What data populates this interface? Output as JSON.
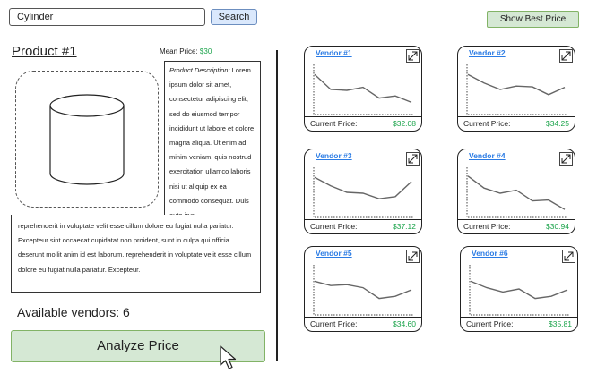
{
  "search": {
    "value": "Cylinder",
    "button_label": "Search"
  },
  "best_price_button": "Show Best Price",
  "product": {
    "title": "Product #1",
    "mean_price_label": "Mean Price:",
    "mean_price_value": "$30",
    "description_label": "Product Description:",
    "description_top": "Lorem ipsum dolor sit amet, consectetur adipiscing elit, sed do eiusmod tempor incididunt ut labore et dolore magna aliqua. Ut enim ad minim veniam, quis nostrud exercitation ullamco laboris nisi ut aliquip ex ea commodo consequat. Duis aute irur.",
    "description_bottom": "reprehenderit in voluptate velit esse cillum dolore eu fugiat nulla pariatur. Excepteur sint occaecat cupidatat non proident, sunt in culpa qui officia deserunt mollit anim id est laborum. reprehenderit in voluptate velit esse cillum dolore eu fugiat nulla pariatur. Excepteur."
  },
  "available_vendors": "Available vendors: 6",
  "analyze_button": "Analyze Price",
  "vendors": [
    {
      "name": "Vendor #1",
      "price_label": "Current Price:",
      "price": "$32.08",
      "trend": [
        0.85,
        0.5,
        0.48,
        0.55,
        0.3,
        0.35,
        0.2
      ]
    },
    {
      "name": "Vendor #2",
      "price_label": "Current Price:",
      "price": "$34.25",
      "trend": [
        0.85,
        0.65,
        0.5,
        0.58,
        0.56,
        0.38,
        0.55
      ]
    },
    {
      "name": "Vendor #3",
      "price_label": "Current Price:",
      "price": "$37.12",
      "trend": [
        0.85,
        0.65,
        0.5,
        0.48,
        0.35,
        0.4,
        0.75
      ]
    },
    {
      "name": "Vendor #4",
      "price_label": "Current Price:",
      "price": "$30.94",
      "trend": [
        0.88,
        0.6,
        0.48,
        0.55,
        0.3,
        0.32,
        0.1
      ]
    },
    {
      "name": "Vendor #5",
      "price_label": "Current Price:",
      "price": "$34.60",
      "trend": [
        0.7,
        0.6,
        0.62,
        0.55,
        0.3,
        0.35,
        0.5
      ]
    },
    {
      "name": "Vendor #6",
      "price_label": "Current Price:",
      "price": "$35.81",
      "trend": [
        0.7,
        0.55,
        0.45,
        0.52,
        0.3,
        0.35,
        0.5
      ]
    }
  ],
  "colors": {
    "accent_green": "#1aa34a",
    "link_blue": "#2a7be4",
    "button_green": "#d5e8d4",
    "button_blue": "#dae8fc"
  }
}
